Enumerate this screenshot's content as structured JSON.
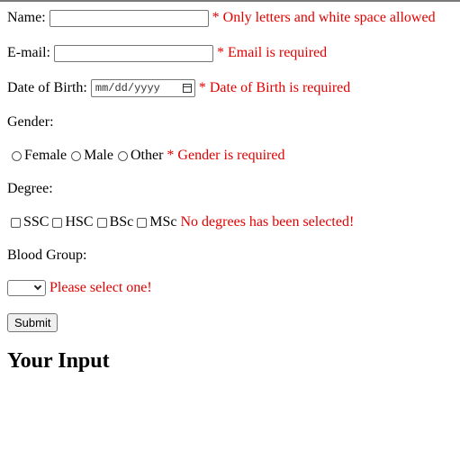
{
  "form": {
    "name": {
      "label": "Name:",
      "value": "",
      "error": "* Only letters and white space allowed"
    },
    "email": {
      "label": "E-mail:",
      "value": "",
      "error": "* Email is required"
    },
    "dob": {
      "label": "Date of Birth:",
      "placeholder": "mm/dd/yyyy",
      "error": "* Date of Birth is required"
    },
    "gender": {
      "label": "Gender:",
      "options": [
        "Female",
        "Male",
        "Other"
      ],
      "error": "* Gender is required"
    },
    "degree": {
      "label": "Degree:",
      "options": [
        "SSC",
        "HSC",
        "BSc",
        "MSc"
      ],
      "error": "No degrees has been selected!"
    },
    "blood_group": {
      "label": "Blood Group:",
      "selected": "",
      "error": "Please select one!"
    },
    "submit_label": "Submit"
  },
  "output": {
    "heading": "Your Input"
  },
  "colors": {
    "error": "#e00000"
  }
}
